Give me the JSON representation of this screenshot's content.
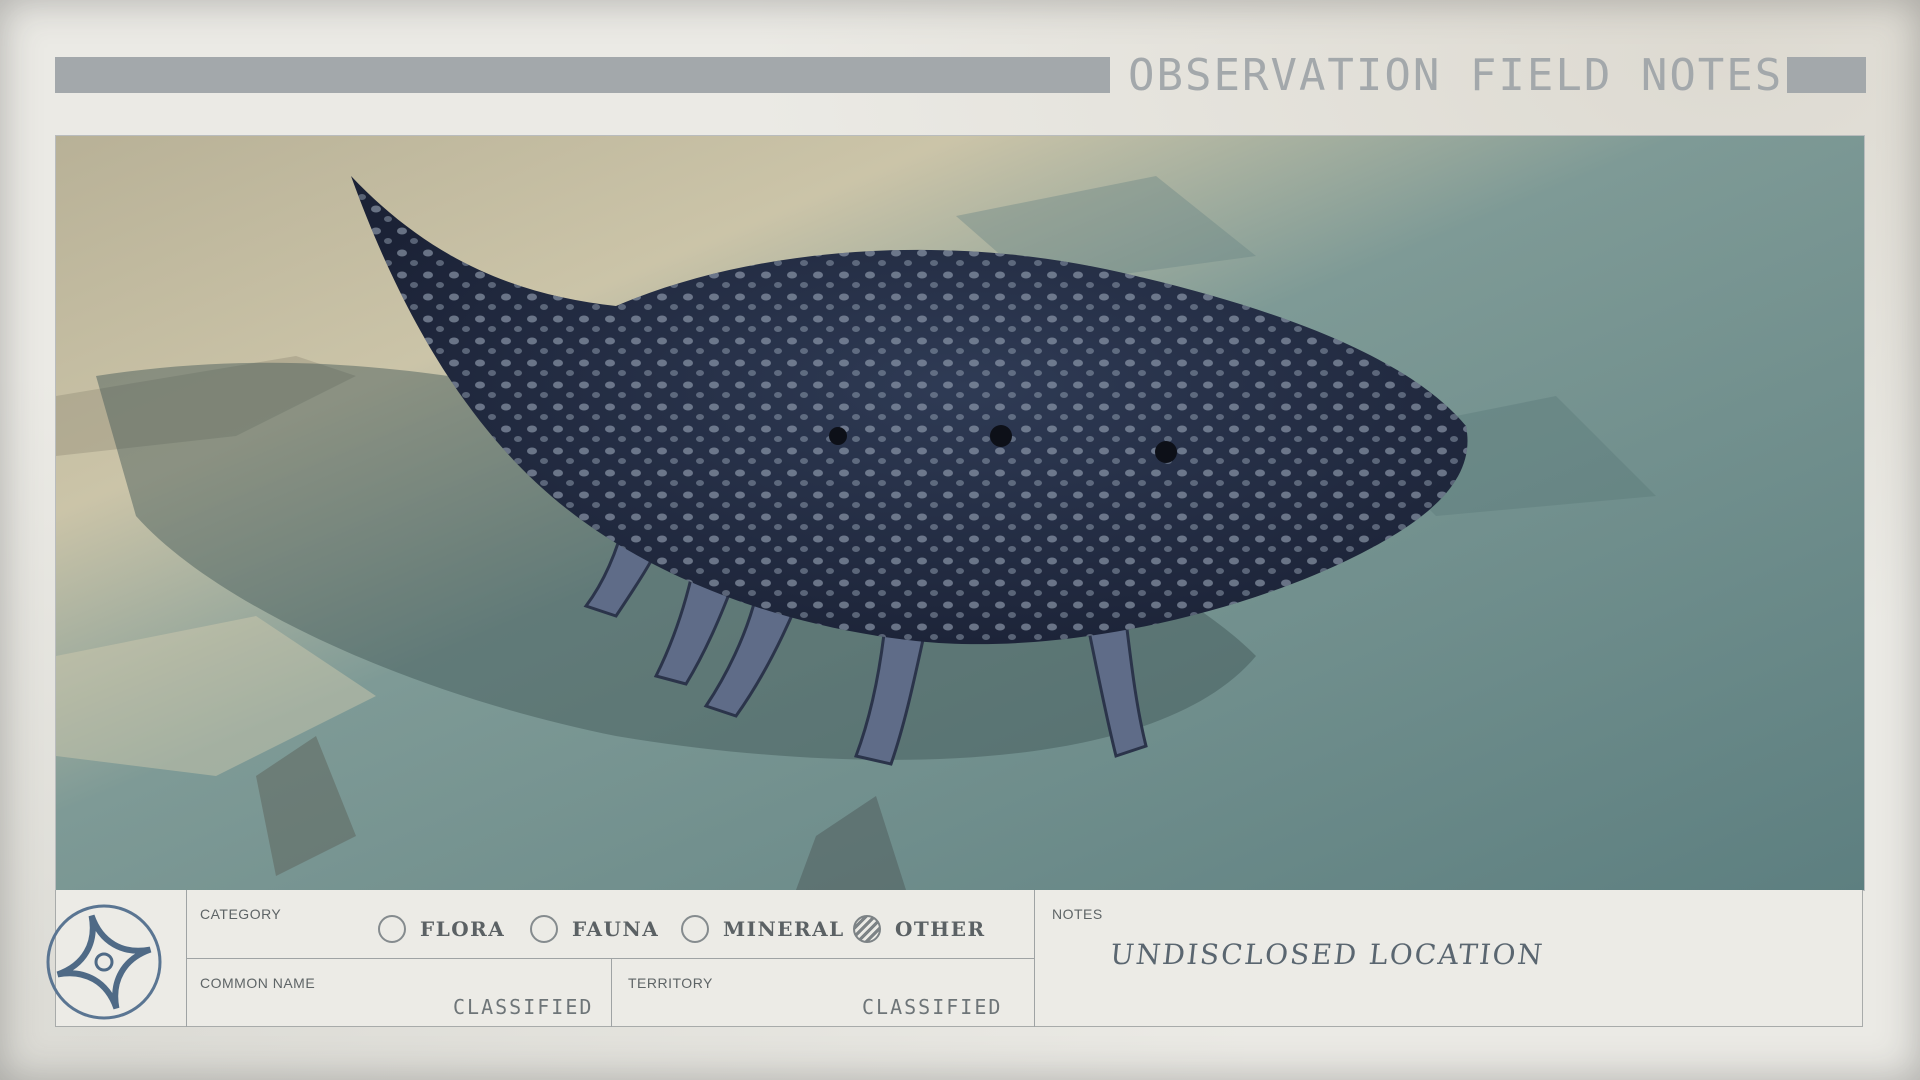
{
  "header": {
    "title": "OBSERVATION FIELD NOTES"
  },
  "photo": {
    "subject_icon": "creature-photo"
  },
  "category": {
    "label": "CATEGORY",
    "options": [
      {
        "label": "FLORA",
        "selected": false
      },
      {
        "label": "FAUNA",
        "selected": false
      },
      {
        "label": "MINERAL",
        "selected": false
      },
      {
        "label": "OTHER",
        "selected": true
      }
    ]
  },
  "common_name": {
    "label": "COMMON NAME",
    "value": "CLASSIFIED"
  },
  "territory": {
    "label": "TERRITORY",
    "value": "CLASSIFIED"
  },
  "notes": {
    "label": "NOTES",
    "value": "UNDISCLOSED LOCATION"
  },
  "colors": {
    "accent_gray": "#a3a8ab",
    "paper": "#ebeae5",
    "emblem_blue": "#4f6a86"
  },
  "emblem": {
    "icon": "star-compass-emblem-icon"
  }
}
